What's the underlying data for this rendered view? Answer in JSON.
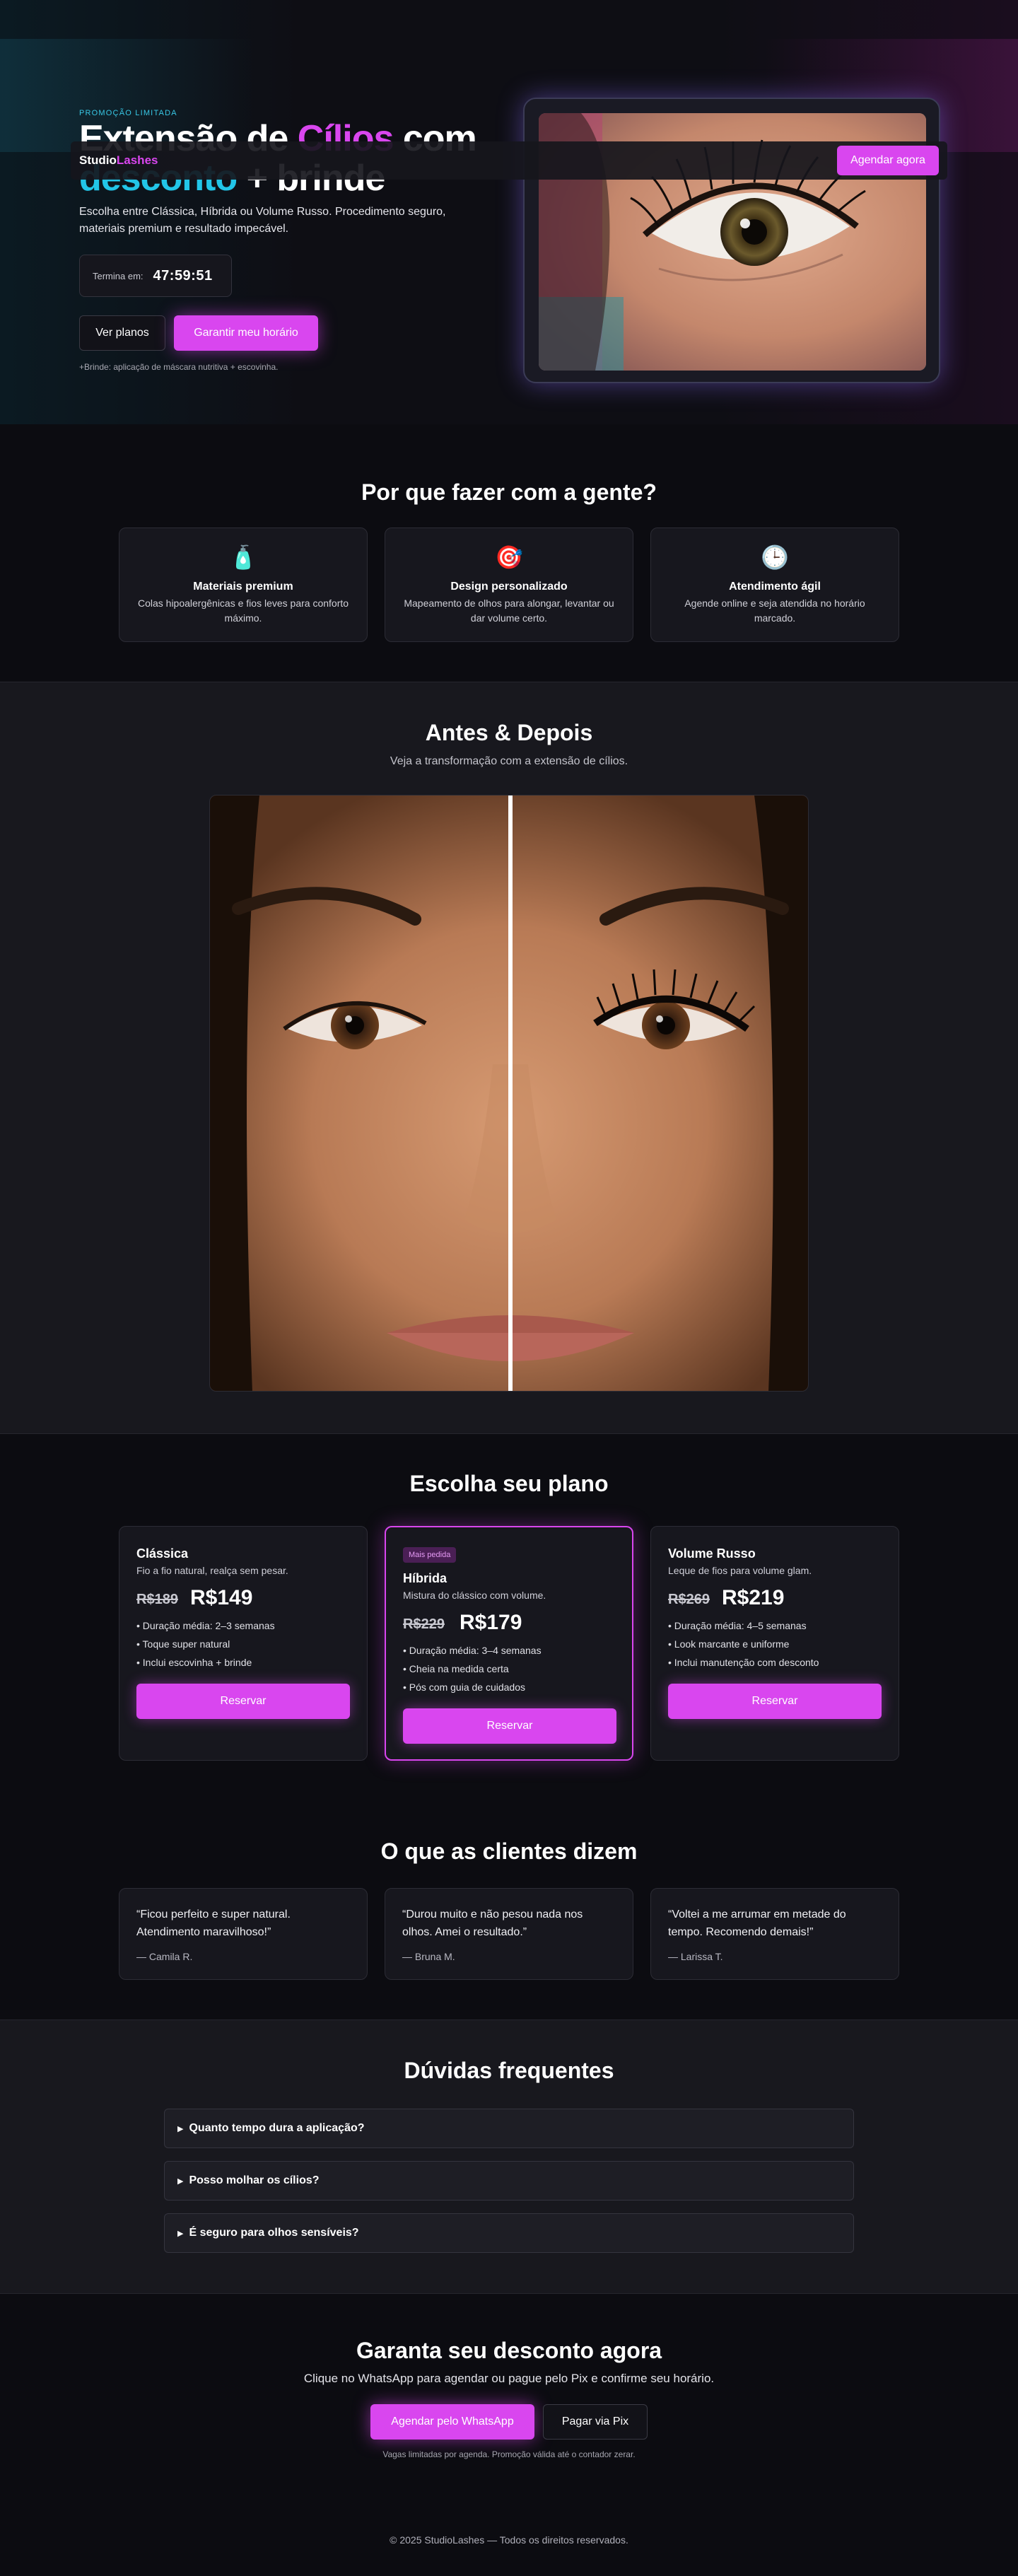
{
  "brand": {
    "name_part1": "Studio",
    "name_part2": "Lashes",
    "accent_color": "#d946ef",
    "secondary_color": "#22c5e8"
  },
  "nav": {
    "cta_label": "Agendar agora"
  },
  "hero": {
    "tag": "PROMOÇÃO LIMITADA",
    "title_part1": "Extensão de ",
    "title_highlight": "Cílios",
    "title_part2": " com",
    "title_line2_highlight": "desconto",
    "title_line2_rest": " + brinde",
    "subtitle": "Escolha entre Clássica, Híbrida ou Volume Russo. Procedimento seguro, materiais premium e resultado impecável.",
    "timer_label": "Termina em:",
    "timer_value": "47:59:51",
    "btn_secondary": "Ver planos",
    "btn_primary": "Garantir meu horário",
    "note": "+Brinde: aplicação de máscara nutritiva + escovinha."
  },
  "why": {
    "title": "Por que fazer com a gente?",
    "items": [
      {
        "icon": "bottle-icon",
        "glyph": "🧴",
        "title": "Materiais premium",
        "text": "Colas hipoalergênicas e fios leves para conforto máximo."
      },
      {
        "icon": "target-icon",
        "glyph": "🎯",
        "title": "Design personalizado",
        "text": "Mapeamento de olhos para alongar, levantar ou dar volume certo."
      },
      {
        "icon": "clock-icon",
        "glyph": "🕒",
        "title": "Atendimento ágil",
        "text": "Agende online e seja atendida no horário marcado."
      }
    ]
  },
  "before_after": {
    "title": "Antes & Depois",
    "subtitle": "Veja a transformação com a extensão de cílios."
  },
  "plans": {
    "title": "Escolha seu plano",
    "items": [
      {
        "name": "Clássica",
        "desc": "Fio a fio natural, realça sem pesar.",
        "old_price": "R$189",
        "price": "R$149",
        "features": [
          "• Duração média: 2–3 semanas",
          "• Toque super natural",
          "• Inclui escovinha + brinde"
        ],
        "button": "Reservar"
      },
      {
        "badge": "Mais pedida",
        "name": "Híbrida",
        "desc": "Mistura do clássico com volume.",
        "old_price": "R$229",
        "price": "R$179",
        "features": [
          "• Duração média: 3–4 semanas",
          "• Cheia na medida certa",
          "• Pós com guia de cuidados"
        ],
        "button": "Reservar"
      },
      {
        "name": "Volume Russo",
        "desc": "Leque de fios para volume glam.",
        "old_price": "R$269",
        "price": "R$219",
        "features": [
          "• Duração média: 4–5 semanas",
          "• Look marcante e uniforme",
          "• Inclui manutenção com desconto"
        ],
        "button": "Reservar"
      }
    ]
  },
  "testimonials": {
    "title": "O que as clientes dizem",
    "items": [
      {
        "quote": "“Ficou perfeito e super natural. Atendimento maravilhoso!”",
        "author": "— Camila R."
      },
      {
        "quote": "“Durou muito e não pesou nada nos olhos. Amei o resultado.”",
        "author": "— Bruna M."
      },
      {
        "quote": "“Voltei a me arrumar em metade do tempo. Recomendo demais!”",
        "author": "— Larissa T."
      }
    ]
  },
  "faq": {
    "title": "Dúvidas frequentes",
    "items": [
      {
        "arrow": "▶",
        "q": "Quanto tempo dura a aplicação?"
      },
      {
        "arrow": "▶",
        "q": "Posso molhar os cílios?"
      },
      {
        "arrow": "▶",
        "q": "É seguro para olhos sensíveis?"
      }
    ]
  },
  "cta": {
    "title": "Garanta seu desconto agora",
    "subtitle": "Clique no WhatsApp para agendar ou pague pelo Pix e confirme seu horário.",
    "btn_whatsapp": "Agendar pelo WhatsApp",
    "btn_pix": "Pagar via Pix",
    "note": "Vagas limitadas por agenda. Promoção válida até o contador zerar."
  },
  "footer": {
    "text": "© 2025 StudioLashes — Todos os direitos reservados."
  }
}
